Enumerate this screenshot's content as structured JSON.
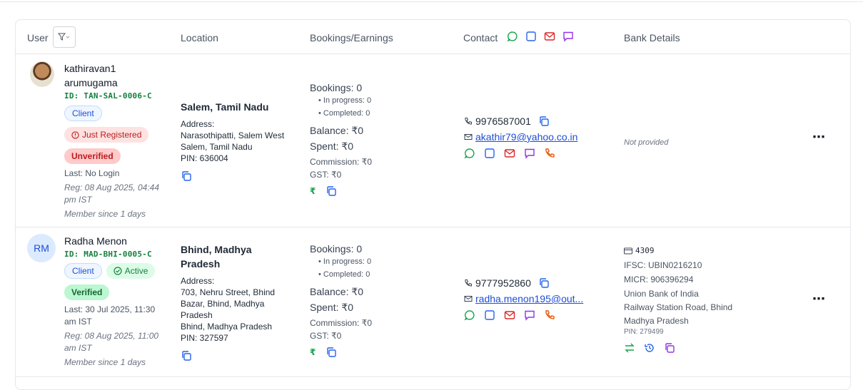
{
  "header": {
    "user": "User",
    "location": "Location",
    "bookings": "Bookings/Earnings",
    "contact": "Contact",
    "bank": "Bank Details"
  },
  "rows": [
    {
      "name_line1": "kathiravan1",
      "name_line2": "arumugama",
      "id": "ID: TAN-SAL-0006-C",
      "role": "Client",
      "status": "Just Registered",
      "verification": "Unverified",
      "last_login": "Last: No Login",
      "reg": "Reg: 08 Aug 2025, 04:44 pm IST",
      "member": "Member since 1 days",
      "location_title": "Salem, Tamil Nadu",
      "address_label": "Address:",
      "address_lines": [
        "Narasothipatti, Salem West",
        "Salem, Tamil Nadu",
        "PIN: 636004"
      ],
      "bookings": "Bookings: 0",
      "in_progress": "• In progress: 0",
      "completed": "• Completed: 0",
      "balance": "Balance: ₹0",
      "spent": "Spent: ₹0",
      "commission": "Commission: ₹0",
      "gst": "GST: ₹0",
      "phone": "9976587001",
      "email": "akathir79@yahoo.co.in",
      "bank_not_provided": "Not provided"
    },
    {
      "initials": "RM",
      "name_line1": "Radha Menon",
      "id": "ID: MAD-BHI-0005-C",
      "role": "Client",
      "status": "Active",
      "verification": "Verified",
      "last_login": "Last: 30 Jul 2025, 11:30 am IST",
      "reg": "Reg: 08 Aug 2025, 11:00 am IST",
      "member": "Member since 1 days",
      "location_title": "Bhind, Madhya Pradesh",
      "address_label": "Address:",
      "address_lines": [
        "703, Nehru Street, Bhind Bazar, Bhind, Madhya Pradesh",
        "Bhind, Madhya Pradesh",
        "PIN: 327597"
      ],
      "bookings": "Bookings: 0",
      "in_progress": "• In progress: 0",
      "completed": "• Completed: 0",
      "balance": "Balance: ₹0",
      "spent": "Spent: ₹0",
      "commission": "Commission: ₹0",
      "gst": "GST: ₹0",
      "phone": "9777952860",
      "email": "radha.menon195@out...",
      "bank_account": "4309",
      "bank_ifsc": "IFSC: UBIN0216210",
      "bank_micr": "MICR: 906396294",
      "bank_name": "Union Bank of India",
      "bank_branch": "Railway Station Road, Bhind Madhya Pradesh",
      "bank_pin": "PIN: 279499"
    }
  ],
  "colors": {
    "whatsapp": "#16a34a",
    "sms": "#2563eb",
    "email": "#dc2626",
    "chat": "#9333ea",
    "call": "#ea580c"
  }
}
